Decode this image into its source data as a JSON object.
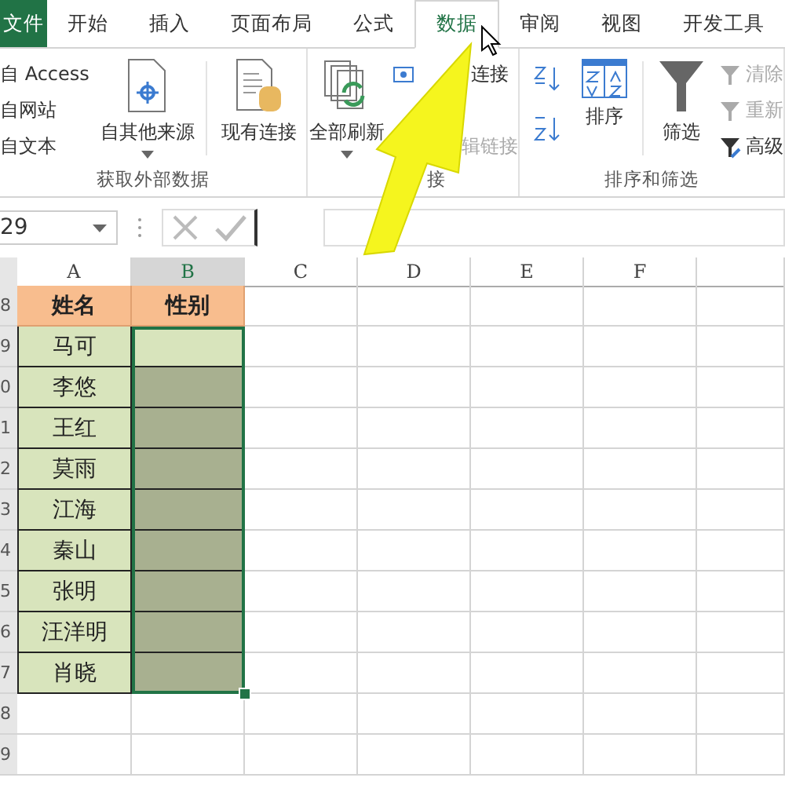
{
  "tabs": [
    {
      "label": "文件",
      "kind": "file",
      "selected": false
    },
    {
      "label": "开始",
      "kind": "tab",
      "selected": false
    },
    {
      "label": "插入",
      "kind": "tab",
      "selected": false
    },
    {
      "label": "页面布局",
      "kind": "tab",
      "selected": false
    },
    {
      "label": "公式",
      "kind": "tab",
      "selected": false
    },
    {
      "label": "数据",
      "kind": "tab",
      "selected": true
    },
    {
      "label": "审阅",
      "kind": "tab",
      "selected": false
    },
    {
      "label": "视图",
      "kind": "tab",
      "selected": false
    },
    {
      "label": "开发工具",
      "kind": "tab",
      "selected": false
    }
  ],
  "ribbon": {
    "external_data": {
      "small_items": [
        "自 Access",
        "自网站",
        "自文本"
      ],
      "other_sources": "自其他来源",
      "existing_connections": "现有连接",
      "label": "获取外部数据"
    },
    "connections": {
      "refresh_all": "全部刷新",
      "connections": "连接",
      "edit_links": "辑链接",
      "label": "接"
    },
    "sort_filter": {
      "sort": "排序",
      "filter": "筛选",
      "clear": {
        "label": "清除",
        "disabled": true
      },
      "reapply": {
        "label": "重新",
        "disabled": true
      },
      "advanced": {
        "label": "高级",
        "disabled": false
      },
      "label": "排序和筛选"
    }
  },
  "name_box": "29",
  "sheet": {
    "columns": [
      "A",
      "B",
      "C",
      "D",
      "E",
      "F"
    ],
    "header": {
      "row_label": "8",
      "name": "姓名",
      "gender": "性别"
    },
    "rows": [
      {
        "row_label": "9",
        "name": "马可",
        "selected": false
      },
      {
        "row_label": "0",
        "name": "李悠",
        "selected": true
      },
      {
        "row_label": "1",
        "name": "王红",
        "selected": true
      },
      {
        "row_label": "2",
        "name": "莫雨",
        "selected": true
      },
      {
        "row_label": "3",
        "name": "江海",
        "selected": true
      },
      {
        "row_label": "4",
        "name": "秦山",
        "selected": true
      },
      {
        "row_label": "5",
        "name": "张明",
        "selected": true
      },
      {
        "row_label": "6",
        "name": "汪洋明",
        "selected": true
      },
      {
        "row_label": "7",
        "name": "肖晓",
        "selected": true
      }
    ],
    "empty_rows": [
      "8",
      "9"
    ]
  }
}
